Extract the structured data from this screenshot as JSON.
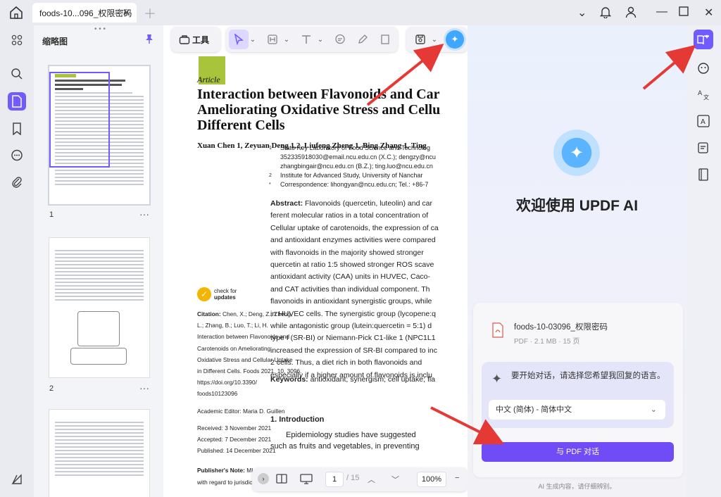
{
  "tab": {
    "title": "foods-10...096_权限密码"
  },
  "thumbnails": {
    "title": "缩略图",
    "pages": [
      "1",
      "2"
    ]
  },
  "toolbar": {
    "tools_label": "工具"
  },
  "doc": {
    "logo": "foods",
    "article_label": "Article",
    "title_lines": [
      "Interaction between Flavonoids and Car",
      "Ameliorating Oxidative Stress and Cellu",
      "Different Cells"
    ],
    "authors": "Xuan Chen 1, Zeyuan Deng 1,2, Liufeng Zheng 1, Bing Zhang 1, Ting",
    "affiliations": [
      "State Key Laboratory of Food Science and Technolog",
      "352335918030@email.ncu.edu.cn (X.C.); dengzy@ncu",
      "zhangbingair@ncu.edu.cn (B.Z.); ting.luo@ncu.edu.cn",
      "Institute for Advanced Study, University of Nanchar",
      "Correspondence: lihongyan@ncu.edu.cn; Tel.: +86-7"
    ],
    "affiliation_marks": [
      "1",
      "",
      "",
      "2",
      "*"
    ],
    "abstract_label": "Abstract:",
    "abstract_lines": [
      "Flavonoids (quercetin, luteolin) and car",
      "ferent molecular ratios in a total concentration of",
      "Cellular uptake of carotenoids, the expression of ca",
      "and antioxidant enzymes activities were compared",
      "with flavonoids in the majority showed stronger",
      "quercetin at ratio 1:5 showed stronger ROS scave",
      "antioxidant activity (CAA) units in HUVEC, Caco-",
      "and CAT activities than individual component. Th",
      "flavonoids in antioxidant synergistic groups, while",
      "in HUVEC cells. The synergistic group (lycopene:q",
      "while antagonistic group (lutein:quercetin = 5:1) d",
      "type I (SR-BI) or Niemann-Pick C1-like 1 (NPC1L1",
      "increased the expression of SR-BI compared to inc",
      "2 cells. Thus, a diet rich in both flavonoids and",
      "especially if a higher amount of flavonoids is inclu"
    ],
    "keywords_label": "Keywords:",
    "keywords": "antioxidant; synergism; cell uptake; fla",
    "intro_heading": "1. Introduction",
    "intro_lines": [
      "Epidemiology studies have suggested",
      "such as fruits and vegetables, in preventing"
    ],
    "check_for": "check for",
    "updates": "updates",
    "citation_label": "Citation:",
    "citation_lines": [
      "Chen, X.; Deng, Z.; Zheng,",
      "L.; Zhang, B.; Luo, T.; Li, H.",
      "Interaction between Flavonoids and",
      "Carotenoids on Ameliorating",
      "Oxidative Stress and Cellular Uptake",
      "in Different Cells. Foods 2021, 10, 3096.",
      "https://doi.org/10.3390/",
      "foods10123096"
    ],
    "editor": "Academic Editor: Maria D. Guillen",
    "received": "Received: 3 November 2021",
    "accepted": "Accepted: 7 December 2021",
    "published": "Published: 14 December 2021",
    "publisher_note_label": "Publisher's Note:",
    "publisher_note_frag": "MI",
    "publisher_note_line2": "with regard to jurisdictional claims in"
  },
  "bottombar": {
    "page": "1",
    "total": "/ 15",
    "zoom": "100%"
  },
  "ai": {
    "welcome": "欢迎使用 UPDF AI",
    "file_name": "foods-10-03096_权限密码",
    "file_meta": "PDF · 2.1 MB · 15 页",
    "lang_prompt": "要开始对话，请选择您希望我回复的语言。",
    "lang_selected": "中文 (简体) - 简体中文",
    "chat_button": "与 PDF 对话",
    "note": "AI 生成内容，请仔细辨别。"
  },
  "colors": {
    "accent": "#6f5bff",
    "chat_button": "#6f4cf5",
    "arrow": "#e53935"
  }
}
